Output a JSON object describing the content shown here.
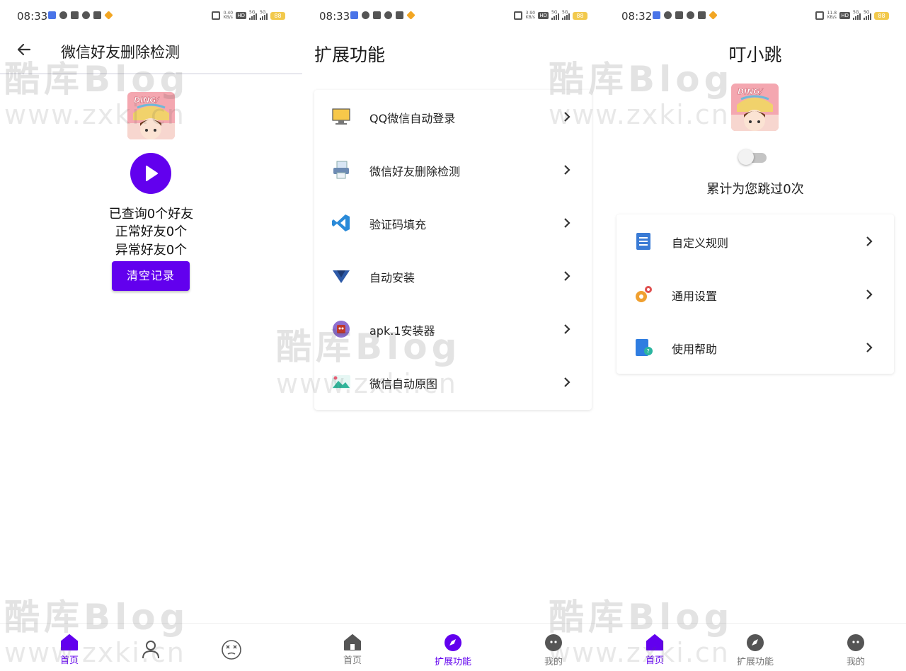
{
  "status_bars": [
    {
      "time": "08:33",
      "speed": "0.40 KB/s",
      "battery": "88"
    },
    {
      "time": "08:33",
      "speed": "3.90 KB/s",
      "battery": "88"
    },
    {
      "time": "08:32",
      "speed": "11.8 KB/s",
      "battery": "88"
    }
  ],
  "signal": {
    "hd": "HD",
    "g5": "5G"
  },
  "screen1": {
    "title": "微信好友删除检测",
    "stat_queried": "已查询0个好友",
    "stat_normal": "正常好友0个",
    "stat_abnormal": "异常好友0个",
    "clear_button": "清空记录",
    "nav": [
      {
        "label": "首页"
      }
    ]
  },
  "screen2": {
    "title": "扩展功能",
    "items": [
      {
        "label": "QQ微信自动登录",
        "icon": "monitor-icon"
      },
      {
        "label": "微信好友删除检测",
        "icon": "printer-icon"
      },
      {
        "label": "验证码填充",
        "icon": "code-icon"
      },
      {
        "label": "自动安装",
        "icon": "install-icon"
      },
      {
        "label": "apk.1安装器",
        "icon": "package-icon"
      },
      {
        "label": "微信自动原图",
        "icon": "image-icon"
      }
    ],
    "nav": [
      {
        "label": "首页"
      },
      {
        "label": "扩展功能"
      },
      {
        "label": "我的"
      }
    ]
  },
  "screen3": {
    "title": "叮小跳",
    "count_text": "累计为您跳过0次",
    "toggle_on": false,
    "items": [
      {
        "label": "自定义规则",
        "icon": "document-icon"
      },
      {
        "label": "通用设置",
        "icon": "gears-icon"
      },
      {
        "label": "使用帮助",
        "icon": "help-book-icon"
      }
    ],
    "nav": [
      {
        "label": "首页"
      },
      {
        "label": "扩展功能"
      },
      {
        "label": "我的"
      }
    ]
  },
  "avatar_text": "DING/",
  "watermark": {
    "brand": "酷库Blog",
    "url": "www.zxki.cn"
  },
  "colors": {
    "accent": "#6200ee",
    "text": "#1a1a1a",
    "muted": "#777777"
  }
}
